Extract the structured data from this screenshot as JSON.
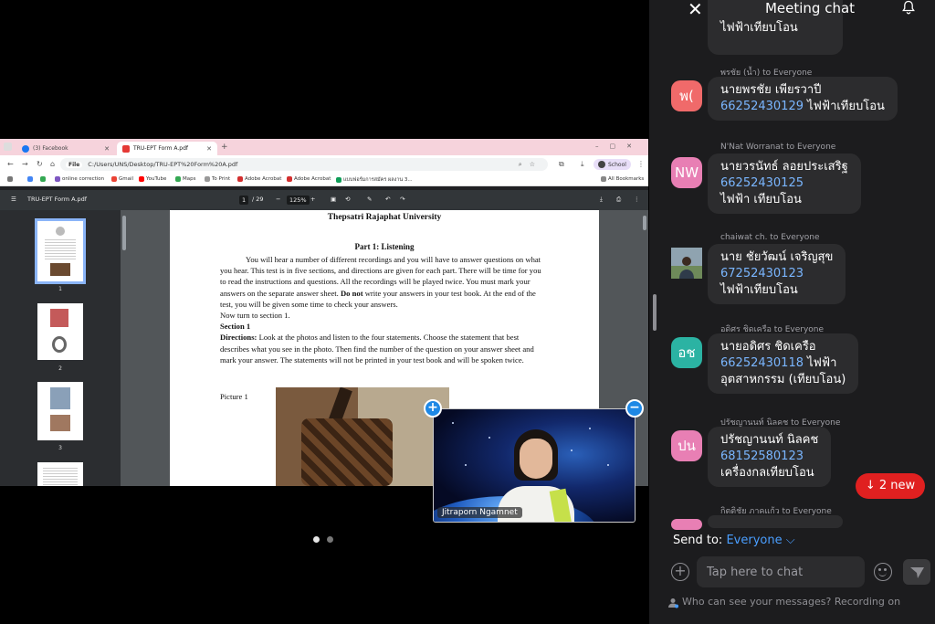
{
  "browser": {
    "tabs": [
      {
        "label": "(3) Facebook"
      },
      {
        "label": "TRU-EPT Form A.pdf"
      }
    ],
    "url_prefix": "File",
    "url": "C:/Users/UNS/Desktop/TRU-EPT%20Form%20A.pdf",
    "profile": "School",
    "bookmarks": [
      "online correction",
      "Gmail",
      "YouTube",
      "Maps",
      "To Print",
      "Adobe Acrobat",
      "Adobe Acrobat",
      "แบบฟอร์มการสมัคร ผลงาน 3...",
      "All Bookmarks"
    ]
  },
  "pdf": {
    "filename": "TRU-EPT Form A.pdf",
    "page_current": "1",
    "page_total": "/ 29",
    "zoom": "125%",
    "thumb_numbers": [
      "1",
      "2",
      "3"
    ],
    "university": "Thepsatri Rajaphat University",
    "part_title": "Part 1: Listening",
    "intro_1": "You will hear a number of different recordings and you will have to answer questions on what you hear. This test is in five sections, and directions are given for each part. There will be time for you to read the instructions and questions. All the recordings will be played twice. You must mark your answers on the separate answer sheet.",
    "intro_bold": "Do not",
    "intro_2": "write your answers in your test book. At the end of the test, you will be given some time to check your answers.",
    "now_turn": "Now turn to section 1.",
    "section": "Section 1",
    "directions_label": "Directions:",
    "directions": "Look at the photos and listen to the four statements. Choose the statement that best describes what you see in the photo. Then find the number of the question on your answer sheet and mark your answer. The statements will not be printed in your test book and will be spoken twice.",
    "picture_label": "Picture 1"
  },
  "video": {
    "participant_name": "Jitraporn Ngamnet",
    "add_symbol": "+",
    "remove_symbol": "−"
  },
  "chat": {
    "title": "Meeting chat",
    "top_message_tail": "ไฟฟ้าเทียบโอน",
    "messages": [
      {
        "sender": "พรชัย (น้ำ) to Everyone",
        "avatar": "พ(",
        "avatar_color": "#f06a6a",
        "lines": [
          [
            "นายพรชัย เพียรวาปี",
            ""
          ],
          [
            "66252430129",
            " ไฟฟ้าเทียบโอน"
          ]
        ]
      },
      {
        "sender": "N'Nat Worranat to Everyone",
        "avatar": "NW",
        "avatar_color": "#e87fb4",
        "lines": [
          [
            "นายวรนัทธ์ ลอยประเสริฐ",
            ""
          ],
          [
            "66252430125",
            ""
          ],
          [
            "ไฟฟ้า เทียบโอน",
            ""
          ]
        ]
      },
      {
        "sender": "chaiwat ch. to Everyone",
        "avatar": "",
        "avatar_color": "#6e8a5a",
        "lines": [
          [
            "นาย ชัยวัฒน์ เจริญสุข",
            ""
          ],
          [
            "67252430123",
            ""
          ],
          [
            "ไฟฟ้าเทียบโอน",
            ""
          ]
        ]
      },
      {
        "sender": "อดิศร ชิดเครือ to Everyone",
        "avatar": "อช",
        "avatar_color": "#2bb3a3",
        "lines": [
          [
            "นายอดิศร ชิดเครือ",
            ""
          ],
          [
            "66252430118",
            " ไฟฟ้า"
          ],
          [
            "อุตสาหกรรม (เทียบโอน)",
            ""
          ]
        ]
      },
      {
        "sender": "ปรัชญานนท์ นิลคช to Everyone",
        "avatar": "ปน",
        "avatar_color": "#e87fb4",
        "lines": [
          [
            "ปรัชญานนท์ นิลคช",
            ""
          ],
          [
            "68152580123",
            ""
          ],
          [
            "เครื่องกลเทียบโอน",
            ""
          ]
        ]
      },
      {
        "sender": "กิตติชัย ภาคแก้ว to Everyone",
        "avatar": "",
        "avatar_color": "#e87fb4",
        "lines": []
      }
    ],
    "new_messages": "↓ 2 new",
    "send_to_label": "Send to:",
    "send_to_value": "Everyone ⌵",
    "input_placeholder": "Tap here to chat",
    "footer_note": "Who can see your messages? Recording on"
  },
  "colors": {
    "accent_blue": "#4a9eff",
    "new_red": "#e02020",
    "chat_bg": "#1c1c1e",
    "bubble": "#2c2c2e"
  }
}
